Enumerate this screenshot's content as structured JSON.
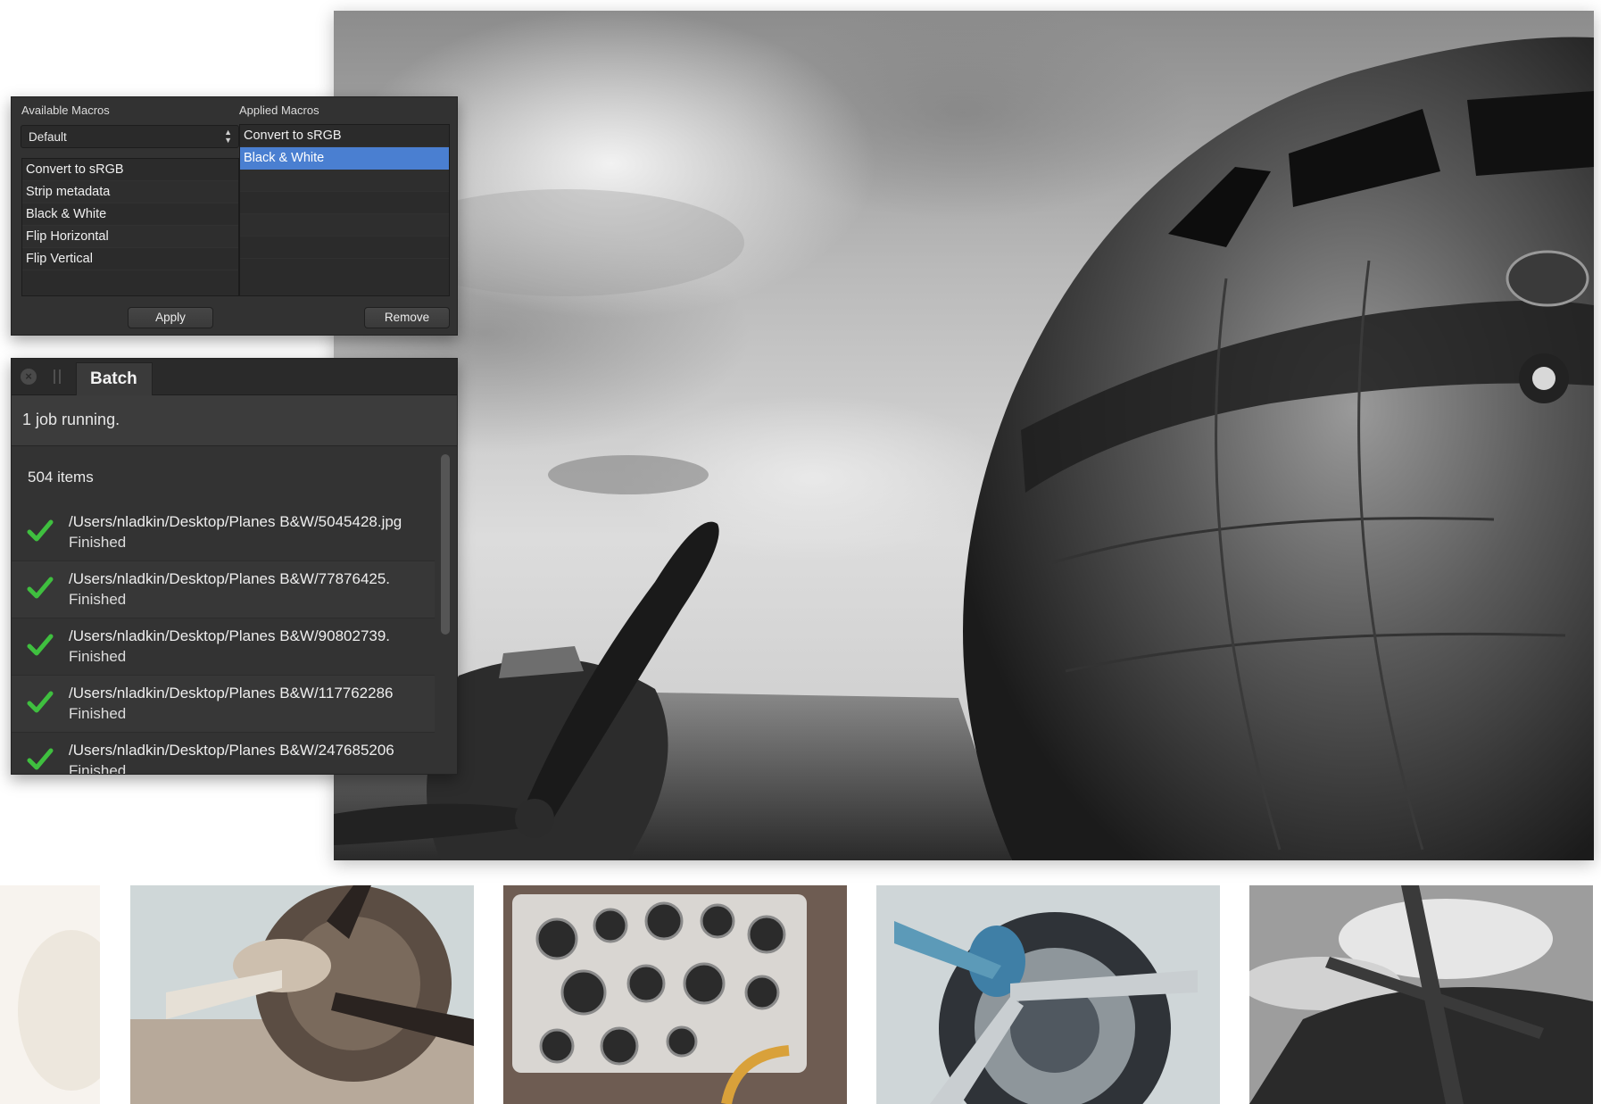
{
  "macros_panel": {
    "available_label": "Available Macros",
    "applied_label": "Applied Macros",
    "category_select": "Default",
    "available_items": [
      {
        "label": "Convert to sRGB"
      },
      {
        "label": "Strip metadata"
      },
      {
        "label": "Black & White"
      },
      {
        "label": "Flip Horizontal"
      },
      {
        "label": "Flip Vertical"
      }
    ],
    "applied_items": [
      {
        "label": "Convert to sRGB"
      },
      {
        "label": "Black & White",
        "selected": true
      }
    ],
    "apply_label": "Apply",
    "remove_label": "Remove"
  },
  "batch_panel": {
    "tab_label": "Batch",
    "status": "1 job running.",
    "item_count": "504 items",
    "jobs": [
      {
        "path": "/Users/nladkin/Desktop/Planes B&W/5045428.jpg",
        "state": "Finished"
      },
      {
        "path": "/Users/nladkin/Desktop/Planes B&W/77876425.",
        "state": "Finished"
      },
      {
        "path": "/Users/nladkin/Desktop/Planes B&W/90802739.",
        "state": "Finished"
      },
      {
        "path": "/Users/nladkin/Desktop/Planes B&W/117762286",
        "state": "Finished"
      },
      {
        "path": "/Users/nladkin/Desktop/Planes B&W/247685206",
        "state": "Finished"
      }
    ]
  },
  "colors": {
    "panel_bg": "#323232",
    "selection": "#4a7fd1",
    "check_green": "#3fbf3f"
  },
  "icons": {
    "close": "close-icon",
    "grip": "grip-icon",
    "select": "chevron-updown-icon",
    "finished": "checkmark-icon"
  }
}
